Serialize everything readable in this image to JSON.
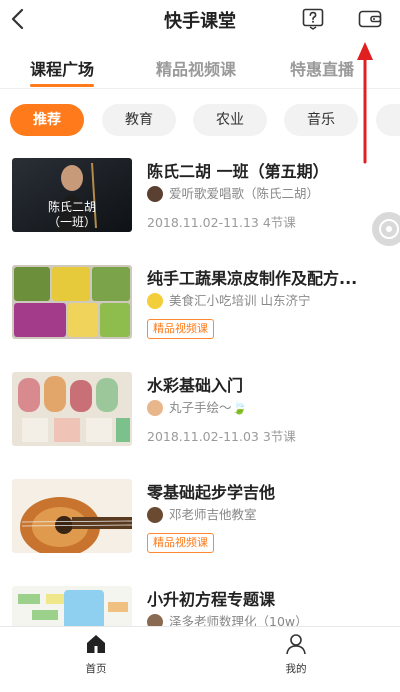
{
  "header": {
    "title": "快手课堂",
    "back_icon": "back-arrow-icon",
    "help_icon": "help-icon",
    "wallet_icon": "wallet-icon"
  },
  "tabs": [
    {
      "label": "课程广场",
      "active": true
    },
    {
      "label": "精品视频课",
      "active": false
    },
    {
      "label": "特惠直播",
      "active": false
    }
  ],
  "chips": [
    {
      "label": "推荐",
      "active": true
    },
    {
      "label": "教育",
      "active": false
    },
    {
      "label": "农业",
      "active": false
    },
    {
      "label": "音乐",
      "active": false
    }
  ],
  "courses": [
    {
      "title": "陈氏二胡 一班（第五期）",
      "author": "爱听歌爱唱歌（陈氏二胡）",
      "meta": "2018.11.02-11.13 4节课",
      "tag": "",
      "thumb_text": [
        "陈氏二胡",
        "（一班）"
      ]
    },
    {
      "title": "纯手工蔬果凉皮制作及配方...",
      "author": "美食汇小吃培训 山东济宁",
      "meta": "",
      "tag": "精品视频课",
      "thumb_text": []
    },
    {
      "title": "水彩基础入门",
      "author": "丸子手绘～🍃",
      "meta": "2018.11.02-11.03 3节课",
      "tag": "",
      "thumb_text": []
    },
    {
      "title": "零基础起步学吉他",
      "author": "邓老师吉他教室",
      "meta": "",
      "tag": "精品视频课",
      "thumb_text": []
    },
    {
      "title": "小升初方程专题课",
      "author": "泽多老师数理化（10w）",
      "meta": "",
      "tag": "",
      "thumb_text": []
    }
  ],
  "bottom_nav": [
    {
      "label": "首页",
      "icon": "home-icon",
      "active": true
    },
    {
      "label": "我的",
      "icon": "profile-icon",
      "active": false
    }
  ],
  "colors": {
    "accent": "#ff7a1a",
    "annotation_arrow": "#e02020"
  }
}
